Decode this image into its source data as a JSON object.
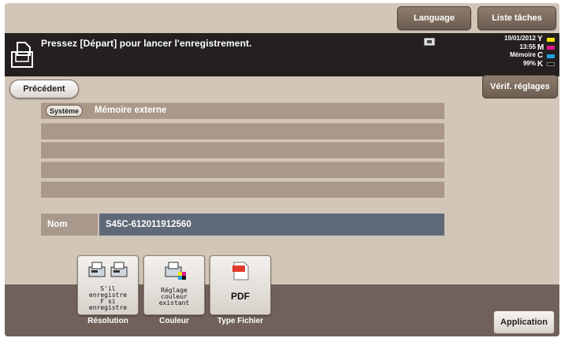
{
  "header": {
    "language_label": "Language",
    "job_list_label": "Liste tâches"
  },
  "message_bar": {
    "message": "Pressez [Départ] pour lancer l'enregistrement.",
    "date": "19/01/2012",
    "time": "13:55",
    "memory_label": "Mémoire",
    "memory_value": "99%",
    "toner": [
      {
        "letter": "Y",
        "color": "#f2e600"
      },
      {
        "letter": "M",
        "color": "#e0188c"
      },
      {
        "letter": "C",
        "color": "#1fa0e0"
      },
      {
        "letter": "K",
        "color": "#222222"
      }
    ]
  },
  "nav": {
    "back_label": "Précédent",
    "check_settings_label": "Vérif. réglages"
  },
  "path_list": {
    "system_badge": "Système",
    "path": "Mémoire externe"
  },
  "name_field": {
    "label": "Nom",
    "value": "S45C-612011912560"
  },
  "functions": [
    {
      "icon": "resolution-icon",
      "lines": [
        "S'il",
        "enregistre",
        "F si",
        "enregistre"
      ],
      "label": "Résolution"
    },
    {
      "icon": "color-icon",
      "lines": [
        "Réglage",
        "couleur",
        "existant"
      ],
      "label": "Couleur"
    },
    {
      "icon": "pdf-icon",
      "value": "PDF",
      "label": "Type Fichier"
    }
  ],
  "application_label": "Application"
}
